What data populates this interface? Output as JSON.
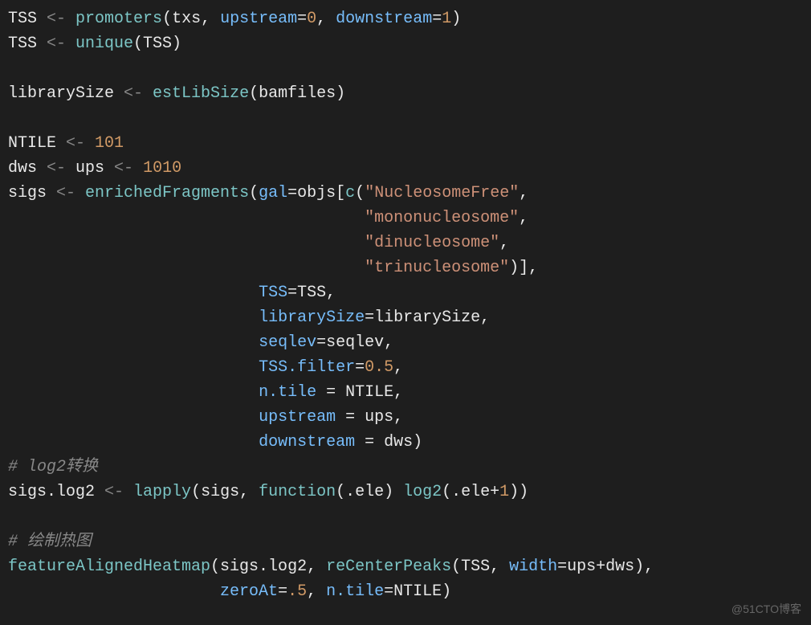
{
  "code": {
    "lines": [
      {
        "segments": [
          {
            "t": "TSS ",
            "c": "white"
          },
          {
            "t": "<- ",
            "c": "assign"
          },
          {
            "t": "promoters",
            "c": "func"
          },
          {
            "t": "(",
            "c": "white"
          },
          {
            "t": "txs",
            "c": "white"
          },
          {
            "t": ", ",
            "c": "white"
          },
          {
            "t": "upstream",
            "c": "param"
          },
          {
            "t": "=",
            "c": "white"
          },
          {
            "t": "0",
            "c": "num"
          },
          {
            "t": ", ",
            "c": "white"
          },
          {
            "t": "downstream",
            "c": "param"
          },
          {
            "t": "=",
            "c": "white"
          },
          {
            "t": "1",
            "c": "num"
          },
          {
            "t": ")",
            "c": "white"
          }
        ]
      },
      {
        "segments": [
          {
            "t": "TSS ",
            "c": "white"
          },
          {
            "t": "<- ",
            "c": "assign"
          },
          {
            "t": "unique",
            "c": "func"
          },
          {
            "t": "(TSS)",
            "c": "white"
          }
        ]
      },
      {
        "segments": [
          {
            "t": " ",
            "c": "white"
          }
        ]
      },
      {
        "segments": [
          {
            "t": "librarySize ",
            "c": "white"
          },
          {
            "t": "<- ",
            "c": "assign"
          },
          {
            "t": "estLibSize",
            "c": "func"
          },
          {
            "t": "(bamfiles)",
            "c": "white"
          }
        ]
      },
      {
        "segments": [
          {
            "t": " ",
            "c": "white"
          }
        ]
      },
      {
        "segments": [
          {
            "t": "NTILE ",
            "c": "white"
          },
          {
            "t": "<- ",
            "c": "assign"
          },
          {
            "t": "101",
            "c": "num"
          }
        ]
      },
      {
        "segments": [
          {
            "t": "dws ",
            "c": "white"
          },
          {
            "t": "<- ",
            "c": "assign"
          },
          {
            "t": "ups ",
            "c": "white"
          },
          {
            "t": "<- ",
            "c": "assign"
          },
          {
            "t": "1010",
            "c": "num"
          }
        ]
      },
      {
        "segments": [
          {
            "t": "sigs ",
            "c": "white"
          },
          {
            "t": "<- ",
            "c": "assign"
          },
          {
            "t": "enrichedFragments",
            "c": "func"
          },
          {
            "t": "(",
            "c": "white"
          },
          {
            "t": "gal",
            "c": "param"
          },
          {
            "t": "=",
            "c": "white"
          },
          {
            "t": "objs",
            "c": "white"
          },
          {
            "t": "[",
            "c": "white"
          },
          {
            "t": "c",
            "c": "func"
          },
          {
            "t": "(",
            "c": "white"
          },
          {
            "t": "\"NucleosomeFree\"",
            "c": "str"
          },
          {
            "t": ",",
            "c": "white"
          }
        ]
      },
      {
        "segments": [
          {
            "t": "                                     ",
            "c": "white"
          },
          {
            "t": "\"mononucleosome\"",
            "c": "str"
          },
          {
            "t": ",",
            "c": "white"
          }
        ]
      },
      {
        "segments": [
          {
            "t": "                                     ",
            "c": "white"
          },
          {
            "t": "\"dinucleosome\"",
            "c": "str"
          },
          {
            "t": ",",
            "c": "white"
          }
        ]
      },
      {
        "segments": [
          {
            "t": "                                     ",
            "c": "white"
          },
          {
            "t": "\"trinucleosome\"",
            "c": "str"
          },
          {
            "t": ")],",
            "c": "white"
          }
        ]
      },
      {
        "segments": [
          {
            "t": "                          ",
            "c": "white"
          },
          {
            "t": "TSS",
            "c": "param"
          },
          {
            "t": "=TSS,",
            "c": "white"
          }
        ]
      },
      {
        "segments": [
          {
            "t": "                          ",
            "c": "white"
          },
          {
            "t": "librarySize",
            "c": "param"
          },
          {
            "t": "=librarySize,",
            "c": "white"
          }
        ]
      },
      {
        "segments": [
          {
            "t": "                          ",
            "c": "white"
          },
          {
            "t": "seqlev",
            "c": "param"
          },
          {
            "t": "=seqlev,",
            "c": "white"
          }
        ]
      },
      {
        "segments": [
          {
            "t": "                          ",
            "c": "white"
          },
          {
            "t": "TSS.filter",
            "c": "param"
          },
          {
            "t": "=",
            "c": "white"
          },
          {
            "t": "0.5",
            "c": "num"
          },
          {
            "t": ",",
            "c": "white"
          }
        ]
      },
      {
        "segments": [
          {
            "t": "                          ",
            "c": "white"
          },
          {
            "t": "n.tile",
            "c": "param"
          },
          {
            "t": " = NTILE,",
            "c": "white"
          }
        ]
      },
      {
        "segments": [
          {
            "t": "                          ",
            "c": "white"
          },
          {
            "t": "upstream",
            "c": "param"
          },
          {
            "t": " = ups,",
            "c": "white"
          }
        ]
      },
      {
        "segments": [
          {
            "t": "                          ",
            "c": "white"
          },
          {
            "t": "downstream",
            "c": "param"
          },
          {
            "t": " = dws)",
            "c": "white"
          }
        ]
      },
      {
        "segments": [
          {
            "t": "# log2转换",
            "c": "comment"
          }
        ]
      },
      {
        "segments": [
          {
            "t": "sigs.log2 ",
            "c": "white"
          },
          {
            "t": "<- ",
            "c": "assign"
          },
          {
            "t": "lapply",
            "c": "func"
          },
          {
            "t": "(sigs, ",
            "c": "white"
          },
          {
            "t": "function",
            "c": "func"
          },
          {
            "t": "(.ele) ",
            "c": "white"
          },
          {
            "t": "log2",
            "c": "func"
          },
          {
            "t": "(.ele+",
            "c": "white"
          },
          {
            "t": "1",
            "c": "num"
          },
          {
            "t": "))",
            "c": "white"
          }
        ]
      },
      {
        "segments": [
          {
            "t": " ",
            "c": "white"
          }
        ]
      },
      {
        "segments": [
          {
            "t": "# 绘制热图",
            "c": "comment"
          }
        ]
      },
      {
        "segments": [
          {
            "t": "featureAlignedHeatmap",
            "c": "func"
          },
          {
            "t": "(sigs.log2, ",
            "c": "white"
          },
          {
            "t": "reCenterPeaks",
            "c": "func"
          },
          {
            "t": "(TSS, ",
            "c": "white"
          },
          {
            "t": "width",
            "c": "param"
          },
          {
            "t": "=ups+dws),",
            "c": "white"
          }
        ]
      },
      {
        "segments": [
          {
            "t": "                      ",
            "c": "white"
          },
          {
            "t": "zeroAt",
            "c": "param"
          },
          {
            "t": "=",
            "c": "white"
          },
          {
            "t": ".5",
            "c": "num"
          },
          {
            "t": ", ",
            "c": "white"
          },
          {
            "t": "n.tile",
            "c": "param"
          },
          {
            "t": "=NTILE)",
            "c": "white"
          }
        ]
      }
    ]
  },
  "watermark": "@51CTO博客"
}
